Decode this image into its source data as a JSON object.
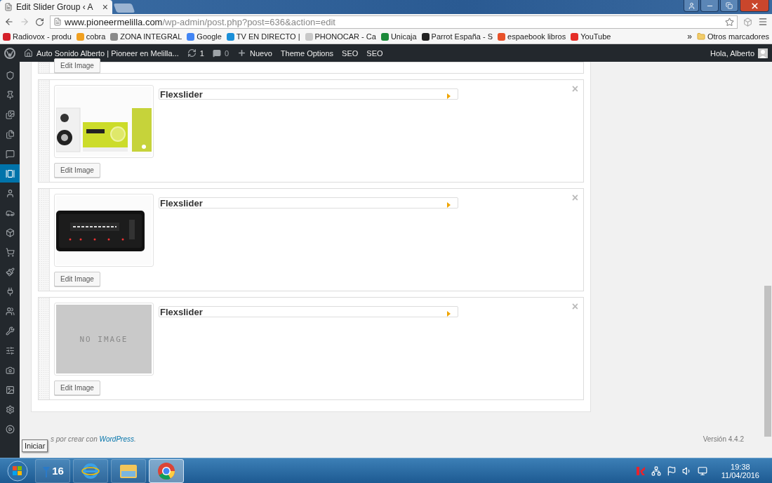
{
  "browser": {
    "tab": {
      "title": "Edit Slider Group ‹ A",
      "close": "×"
    },
    "address": {
      "host": "www.pioneermelilla.com",
      "path": "/wp-admin/post.php?post=636&action=edit"
    },
    "bookmarks": [
      {
        "label": "Radiovox - produ",
        "color": "#d4202a"
      },
      {
        "label": "cobra",
        "color": "#f0a020"
      },
      {
        "label": "ZONA INTEGRAL",
        "color": "#8a8a8a"
      },
      {
        "label": "Google",
        "color": "#4285f4"
      },
      {
        "label": "TV EN DIRECTO |",
        "color": "#1a8fd8"
      },
      {
        "label": "PHONOCAR - Ca",
        "color": "#c8c8c8"
      },
      {
        "label": "Unicaja",
        "color": "#1c8a3a"
      },
      {
        "label": "Parrot España - S",
        "color": "#222222"
      },
      {
        "label": "espaebook libros",
        "color": "#e8522a"
      },
      {
        "label": "YouTube",
        "color": "#e52d27"
      }
    ],
    "more": "»",
    "other_bookmarks": "Otros marcadores"
  },
  "admin_bar": {
    "site": "Auto Sonido Alberto | Pioneer en Melilla...",
    "updates": "1",
    "comments": "0",
    "new": "Nuevo",
    "links": [
      "Theme Options",
      "SEO",
      "SEO"
    ],
    "greeting": "Hola, Alberto"
  },
  "sidebar": {
    "items": [
      {
        "selected": false
      },
      {
        "selected": false
      },
      {
        "selected": false
      },
      {
        "selected": false
      },
      {
        "selected": false
      },
      {
        "selected": true
      },
      {
        "selected": false
      },
      {
        "selected": false
      },
      {
        "selected": false
      },
      {
        "selected": false
      },
      {
        "selected": false
      },
      {
        "selected": false
      },
      {
        "selected": false
      },
      {
        "selected": false
      },
      {
        "selected": false
      },
      {
        "selected": false
      },
      {
        "selected": false
      },
      {
        "selected": false
      },
      {
        "selected": false
      }
    ]
  },
  "slides": [
    {
      "kind": "cut",
      "button": "Edit Image"
    },
    {
      "kind": "full",
      "title": "Flexslider",
      "close": "×",
      "button": "Edit Image"
    },
    {
      "kind": "full",
      "title": "Flexslider",
      "close": "×",
      "button": "Edit Image"
    },
    {
      "kind": "full",
      "image": {
        "kind": "placeholder",
        "text": "NO IMAGE"
      },
      "title": "Flexslider",
      "close": "×",
      "button": "Edit Image"
    }
  ],
  "footer": {
    "text": "s por crear con ",
    "link": "WordPress",
    "end": ".",
    "version": "Versión 4.4.2"
  },
  "tooltip": "Iniciar",
  "taskbar": {
    "apps": [
      {
        "label": "16",
        "selected": false
      },
      {
        "selected": false
      },
      {
        "selected": false
      },
      {
        "selected": true
      }
    ],
    "clock": {
      "time": "19:38",
      "date": "11/04/2016"
    }
  }
}
